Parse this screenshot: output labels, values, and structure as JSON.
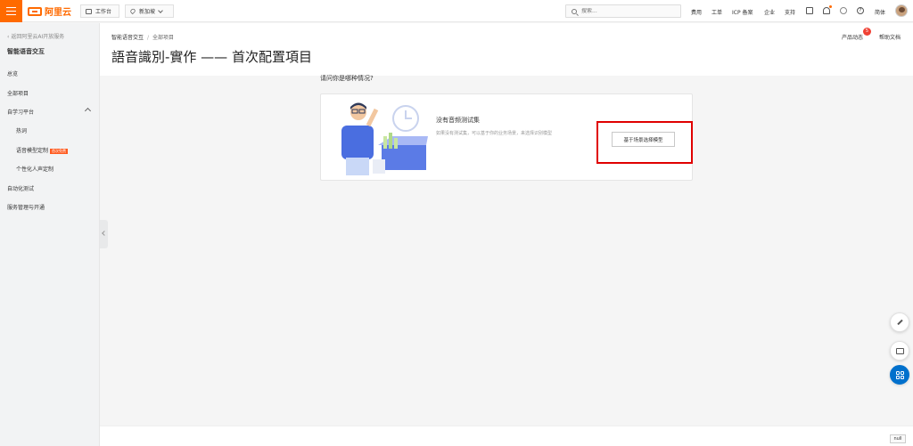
{
  "topbar": {
    "logo": "阿里云",
    "workbench": "工作台",
    "region": "新加坡",
    "search_placeholder": "搜索...",
    "links": [
      "费用",
      "工单",
      "ICP 备案",
      "企业",
      "支持"
    ],
    "language": "简体"
  },
  "sidebar": {
    "back": "返回阿里云AI开放服务",
    "title": "智能语音交互",
    "items": [
      {
        "label": "总览"
      },
      {
        "label": "全部项目"
      },
      {
        "label": "自学习平台"
      },
      {
        "label": "热词"
      },
      {
        "label": "语音模型定制",
        "badge": "首次免费"
      },
      {
        "label": "个性化人声定制"
      },
      {
        "label": "自动化测试"
      },
      {
        "label": "服务管理与开通"
      }
    ]
  },
  "header": {
    "breadcrumb": [
      "智能语音交互",
      "全部项目"
    ],
    "title": "語音識別-實作 —— 首次配置項目",
    "product_news": "产品动态",
    "news_count": "5",
    "help": "帮助文档"
  },
  "main": {
    "question": "请问你是哪种情况?",
    "card": {
      "title": "没有音频测试集",
      "desc": "如果没有测试集，可以基于你的业务场景，来选择识别模型",
      "button": "基于场景选择模型"
    }
  },
  "footer": {
    "null_label": "null"
  },
  "colors": {
    "accent": "#ff6a00",
    "highlight": "#e00000",
    "fab_blue": "#0070cc"
  }
}
